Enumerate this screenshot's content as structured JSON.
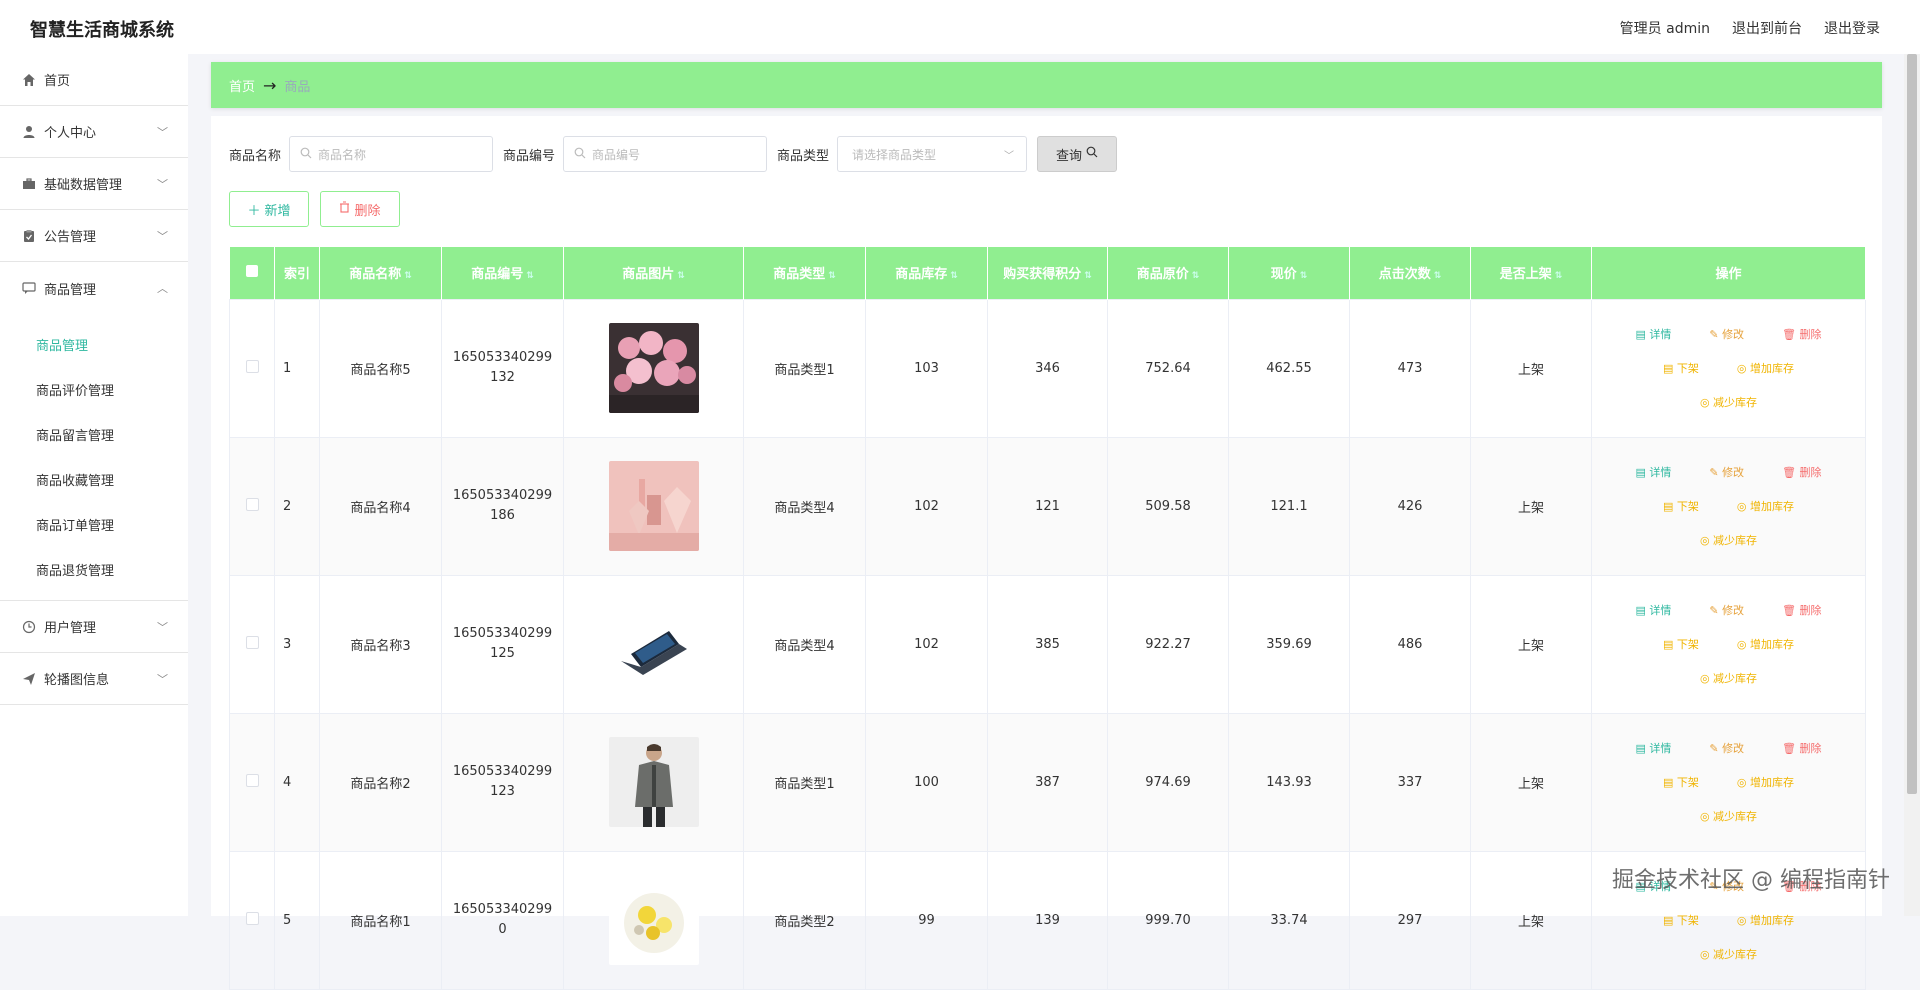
{
  "app": {
    "title": "智慧生活商城系统"
  },
  "header": {
    "user": "管理员 admin",
    "to_front": "退出到前台",
    "logout": "退出登录"
  },
  "sidebar": {
    "items": [
      {
        "label": "首页",
        "icon": "home-icon"
      },
      {
        "label": "个人中心",
        "icon": "user-icon"
      },
      {
        "label": "基础数据管理",
        "icon": "briefcase-icon"
      },
      {
        "label": "公告管理",
        "icon": "clipboard-icon"
      },
      {
        "label": "商品管理",
        "icon": "chat-icon"
      },
      {
        "label": "用户管理",
        "icon": "clock-icon"
      },
      {
        "label": "轮播图信息",
        "icon": "send-icon"
      }
    ],
    "submenu": [
      {
        "label": "商品管理",
        "active": true
      },
      {
        "label": "商品评价管理"
      },
      {
        "label": "商品留言管理"
      },
      {
        "label": "商品收藏管理"
      },
      {
        "label": "商品订单管理"
      },
      {
        "label": "商品退货管理"
      }
    ]
  },
  "breadcrumb": {
    "home": "首页",
    "arrow": "→",
    "current": "商品"
  },
  "filters": {
    "name_label": "商品名称",
    "name_placeholder": "商品名称",
    "code_label": "商品编号",
    "code_placeholder": "商品编号",
    "type_label": "商品类型",
    "type_placeholder": "请选择商品类型",
    "query": "查询"
  },
  "actions": {
    "add": "新增",
    "delete": "删除"
  },
  "table": {
    "columns": [
      "",
      "索引",
      "商品名称",
      "商品编号",
      "商品图片",
      "商品类型",
      "商品库存",
      "购买获得积分",
      "商品原价",
      "现价",
      "点击次数",
      "是否上架",
      "操作"
    ],
    "ops": {
      "detail": "详情",
      "edit": "修改",
      "delete": "删除",
      "down": "下架",
      "inc": "增加库存",
      "dec": "减少库存"
    },
    "rows": [
      {
        "idx": "1",
        "name": "商品名称5",
        "code": "165053340299132",
        "type": "商品类型1",
        "stock": "103",
        "points": "346",
        "orig": "752.64",
        "price": "462.55",
        "clicks": "473",
        "status": "上架",
        "img": "flowers"
      },
      {
        "idx": "2",
        "name": "商品名称4",
        "code": "165053340299186",
        "type": "商品类型4",
        "stock": "102",
        "points": "121",
        "orig": "509.58",
        "price": "121.1",
        "clicks": "426",
        "status": "上架",
        "img": "cosmetics"
      },
      {
        "idx": "3",
        "name": "商品名称3",
        "code": "165053340299125",
        "type": "商品类型4",
        "stock": "102",
        "points": "385",
        "orig": "922.27",
        "price": "359.69",
        "clicks": "486",
        "status": "上架",
        "img": "laptop"
      },
      {
        "idx": "4",
        "name": "商品名称2",
        "code": "165053340299123",
        "type": "商品类型1",
        "stock": "100",
        "points": "387",
        "orig": "974.69",
        "price": "143.93",
        "clicks": "337",
        "status": "上架",
        "img": "jacket"
      },
      {
        "idx": "5",
        "name": "商品名称1",
        "code": "1650533402990",
        "type": "商品类型2",
        "stock": "99",
        "points": "139",
        "orig": "999.70",
        "price": "33.74",
        "clicks": "297",
        "status": "上架",
        "img": "food"
      }
    ]
  },
  "watermark": "掘金技术社区 @ 编程指南针"
}
